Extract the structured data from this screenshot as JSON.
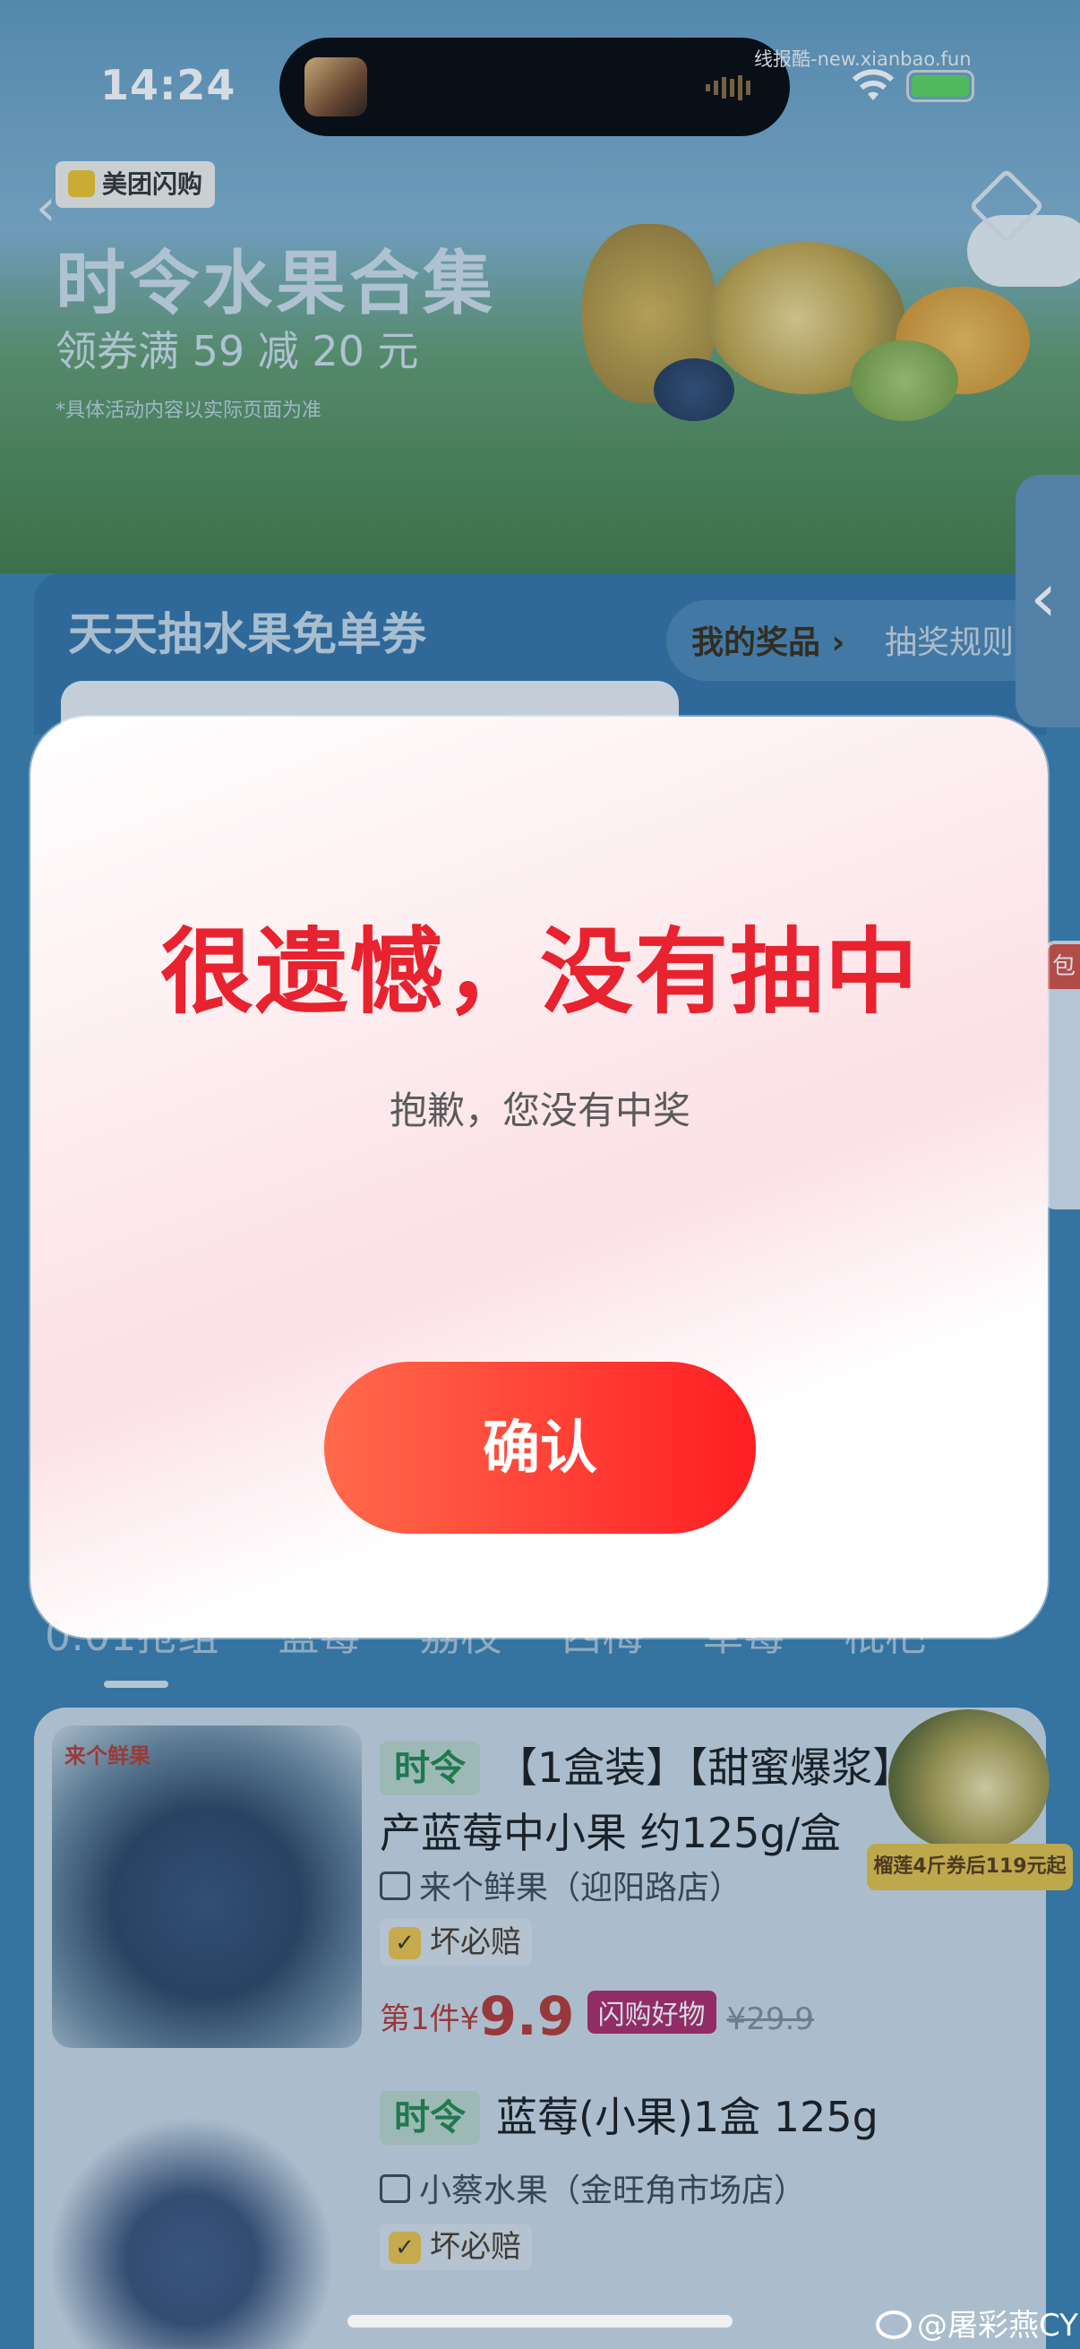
{
  "status_bar": {
    "time": "14:24",
    "watermark": "线报酷-new.xianbao.fun"
  },
  "banner": {
    "brand": "美团闪购",
    "title": "时令水果合集",
    "subtitle": "领券满 59 减 20 元",
    "note": "*具体活动内容以实际页面为准"
  },
  "lottery": {
    "title": "天天抽水果免单券",
    "my_prizes": "我的奖品 ›",
    "rules": "抽奖规则"
  },
  "side_promo_tag": "包",
  "tabs": [
    "0.01抢组",
    "蓝莓",
    "荔枝",
    "西梅",
    "草莓",
    "枇杷"
  ],
  "products": [
    {
      "logo": "来个鲜果",
      "badge": "时令",
      "title_line1": "【1盒装】【甜蜜爆浆】国",
      "title_line2": "产蓝莓中小果 约125g/盒",
      "shop": "来个鲜果（迎阳路店）",
      "guarantee": "坏必赔",
      "price_prefix": "第1件¥",
      "price": "9.9",
      "flash_tag": "闪购好物",
      "original_price": "¥29.9"
    },
    {
      "badge": "时令",
      "title": "蓝莓(小果)1盒 125g",
      "shop": "小蔡水果（金旺角市场店）",
      "guarantee": "坏必赔"
    }
  ],
  "durian_ad": "榴莲4斤券后119元起",
  "dialog": {
    "title": "很遗憾，没有抽中",
    "message": "抱歉，您没有中奖",
    "confirm": "确认"
  },
  "weibo_watermark": "@屠彩燕CY",
  "colors": {
    "dialog_title": "#e8222e",
    "button_start": "#ff6a4c",
    "button_end": "#ff1e23",
    "badge_green": "#1a8a48"
  }
}
